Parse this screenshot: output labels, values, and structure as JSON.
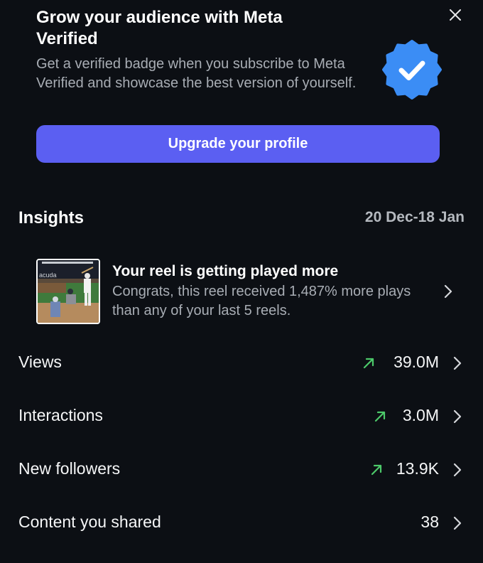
{
  "promo": {
    "title": "Grow your audience with Meta Verified",
    "description": "Get a verified badge when you subscribe to Meta Verified and showcase the best version of yourself.",
    "button_label": "Upgrade your profile",
    "close_icon": "close-icon",
    "badge_icon": "verified-badge-icon",
    "badge_color": "#3b8df5",
    "button_color": "#5b5ff2"
  },
  "insights": {
    "title": "Insights",
    "date_range": "20 Dec-18 Jan",
    "reel": {
      "title": "Your reel is getting played more",
      "description": "Congrats, this reel received 1,487% more plays than any of your last 5 reels.",
      "thumbnail_text": "acuda",
      "chevron_icon": "chevron-right-icon"
    },
    "metrics": [
      {
        "label": "Views",
        "value": "39.0M",
        "trend": "up"
      },
      {
        "label": "Interactions",
        "value": "3.0M",
        "trend": "up"
      },
      {
        "label": "New followers",
        "value": "13.9K",
        "trend": "up"
      },
      {
        "label": "Content you shared",
        "value": "38",
        "trend": "none"
      }
    ],
    "trend_color": "#4cc96a"
  }
}
